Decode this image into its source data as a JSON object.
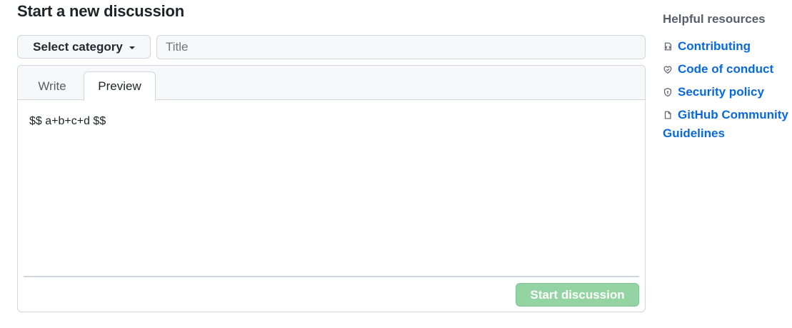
{
  "page": {
    "title": "Start a new discussion"
  },
  "form": {
    "category_label": "Select category",
    "title_placeholder": "Title",
    "title_value": ""
  },
  "editor": {
    "tabs": [
      {
        "label": "Write",
        "active": false
      },
      {
        "label": "Preview",
        "active": true
      }
    ],
    "preview_content": "$$ a+b+c+d $$",
    "submit_label": "Start discussion",
    "submit_disabled": true
  },
  "sidebar": {
    "heading": "Helpful resources",
    "items": [
      {
        "label": "Contributing",
        "icon": "contributing-icon"
      },
      {
        "label": "Code of conduct",
        "icon": "code-of-conduct-icon"
      },
      {
        "label": "Security policy",
        "icon": "shield-icon"
      },
      {
        "label": "GitHub Community Guidelines",
        "icon": "file-icon"
      }
    ]
  },
  "colors": {
    "link": "#0969da",
    "submit_disabled_bg": "#94d3a2",
    "border": "#d0d7de",
    "header_bg": "#f6f8fa"
  }
}
